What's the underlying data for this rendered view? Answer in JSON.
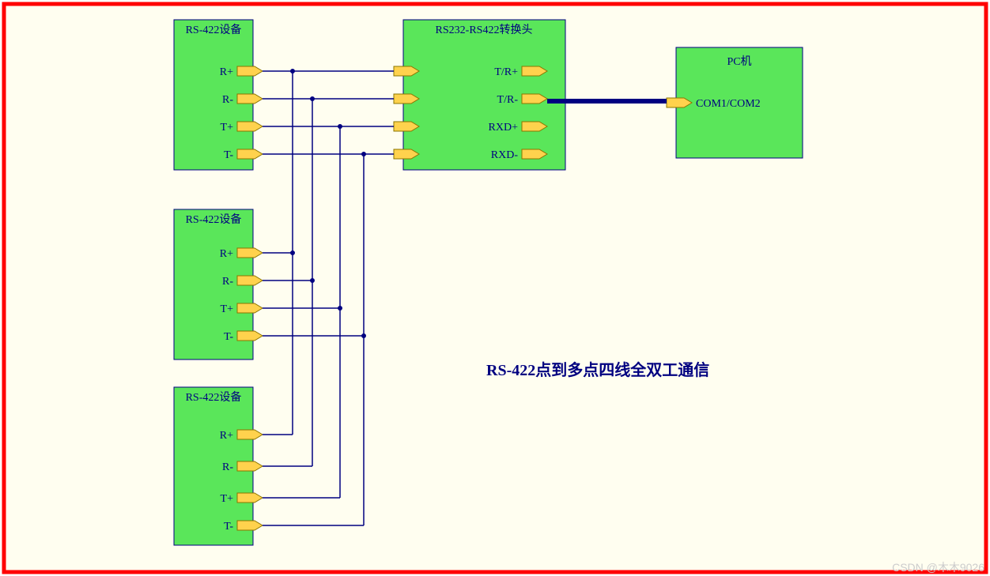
{
  "title": "RS-422点到多点四线全双工通信",
  "watermark": "CSDN @木木9026",
  "blocks": {
    "device1": {
      "title": "RS-422设备",
      "pins": [
        "R+",
        "R-",
        "T+",
        "T-"
      ]
    },
    "device2": {
      "title": "RS-422设备",
      "pins": [
        "R+",
        "R-",
        "T+",
        "T-"
      ]
    },
    "device3": {
      "title": "RS-422设备",
      "pins": [
        "R+",
        "R-",
        "T+",
        "T-"
      ]
    },
    "converter": {
      "title": "RS232-RS422转换头",
      "pins_left": [
        "",
        "",
        "",
        ""
      ],
      "pins_right": [
        "T/R+",
        "T/R-",
        "RXD+",
        "RXD-"
      ]
    },
    "pc": {
      "title": "PC机",
      "pin": "COM1/COM2"
    }
  }
}
